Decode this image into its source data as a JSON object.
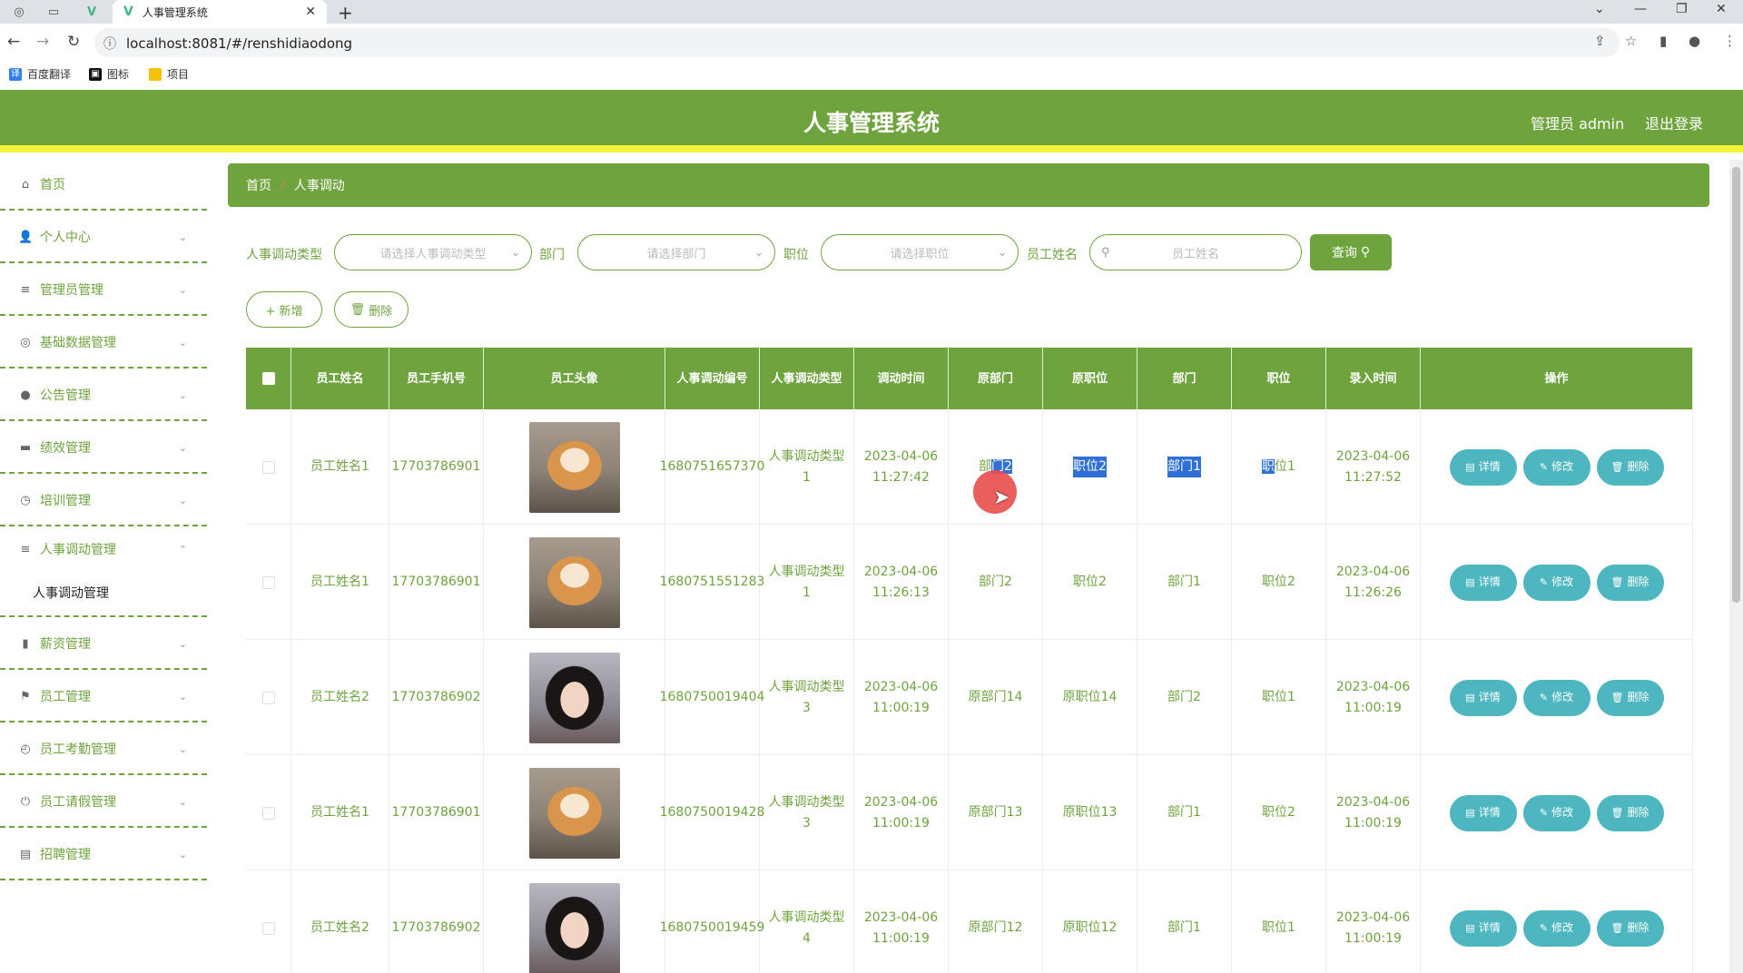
{
  "browser": {
    "tab_title": "人事管理系统",
    "url": "localhost:8081/#/renshidiaodong",
    "bookmarks": [
      {
        "label": "百度翻译",
        "color": "#2f80ed",
        "icon": "translate-icon"
      },
      {
        "label": "图标",
        "color": "#111111",
        "icon": "image-icon"
      },
      {
        "label": "项目",
        "color": "#f4c20d",
        "icon": "folder-icon"
      }
    ]
  },
  "header": {
    "title": "人事管理系统",
    "user": "管理员 admin",
    "logout": "退出登录"
  },
  "colors": {
    "primary": "#6ea33e",
    "accent": "#f1f43a",
    "action": "#4db6bf",
    "selection": "#2f6fd6"
  },
  "sidebar": {
    "items": [
      {
        "label": "首页",
        "icon": "home-icon"
      },
      {
        "label": "个人中心",
        "icon": "user-icon"
      },
      {
        "label": "管理员管理",
        "icon": "list-icon"
      },
      {
        "label": "基础数据管理",
        "icon": "settings-icon"
      },
      {
        "label": "公告管理",
        "icon": "pin-icon"
      },
      {
        "label": "绩效管理",
        "icon": "chat-icon"
      },
      {
        "label": "培训管理",
        "icon": "compass-icon"
      },
      {
        "label": "人事调动管理",
        "icon": "menu-icon",
        "expanded": true
      },
      {
        "label": "薪资管理",
        "icon": "bar-chart-icon"
      },
      {
        "label": "员工管理",
        "icon": "flag-icon"
      },
      {
        "label": "员工考勤管理",
        "icon": "clock-icon"
      },
      {
        "label": "员工请假管理",
        "icon": "power-icon"
      },
      {
        "label": "招聘管理",
        "icon": "card-icon"
      }
    ],
    "sub_item": "人事调动管理"
  },
  "breadcrumb": {
    "home": "首页",
    "separator": "/",
    "current": "人事调动"
  },
  "search": {
    "type_label": "人事调动类型",
    "type_placeholder": "请选择人事调动类型",
    "dept_label": "部门",
    "dept_placeholder": "请选择部门",
    "pos_label": "职位",
    "pos_placeholder": "请选择职位",
    "name_label": "员工姓名",
    "name_placeholder": "员工姓名",
    "query_button": "查询"
  },
  "actions": {
    "add": "+ 新增",
    "delete": "删除"
  },
  "table": {
    "columns": [
      "员工姓名",
      "员工手机号",
      "员工头像",
      "人事调动编号",
      "人事调动类型",
      "调动时间",
      "原部门",
      "原职位",
      "部门",
      "职位",
      "录入时间",
      "操作"
    ],
    "op_labels": {
      "detail": "详情",
      "edit": "修改",
      "delete": "删除"
    },
    "rows": [
      {
        "name": "员工姓名1",
        "phone": "17703786901",
        "avatar": "dog",
        "code": "1680751657370",
        "type": "人事调动类型1",
        "time": "2023-04-06 11:27:42",
        "old_dept": "部门2",
        "old_pos": "职位2",
        "dept": "部门1",
        "pos": "职位1",
        "created": "2023-04-06 11:27:52"
      },
      {
        "name": "员工姓名1",
        "phone": "17703786901",
        "avatar": "dog",
        "code": "1680751551283",
        "type": "人事调动类型1",
        "time": "2023-04-06 11:26:13",
        "old_dept": "部门2",
        "old_pos": "职位2",
        "dept": "部门1",
        "pos": "职位2",
        "created": "2023-04-06 11:26:26"
      },
      {
        "name": "员工姓名2",
        "phone": "17703786902",
        "avatar": "girl",
        "code": "1680750019404",
        "type": "人事调动类型3",
        "time": "2023-04-06 11:00:19",
        "old_dept": "原部门14",
        "old_pos": "原职位14",
        "dept": "部门2",
        "pos": "职位1",
        "created": "2023-04-06 11:00:19"
      },
      {
        "name": "员工姓名1",
        "phone": "17703786901",
        "avatar": "dog",
        "code": "1680750019428",
        "type": "人事调动类型3",
        "time": "2023-04-06 11:00:19",
        "old_dept": "原部门13",
        "old_pos": "原职位13",
        "dept": "部门1",
        "pos": "职位2",
        "created": "2023-04-06 11:00:19"
      },
      {
        "name": "员工姓名2",
        "phone": "17703786902",
        "avatar": "girl",
        "code": "1680750019459",
        "type": "人事调动类型4",
        "time": "2023-04-06 11:00:19",
        "old_dept": "原部门12",
        "old_pos": "原职位12",
        "dept": "部门1",
        "pos": "职位1",
        "created": "2023-04-06 11:00:19"
      }
    ]
  }
}
